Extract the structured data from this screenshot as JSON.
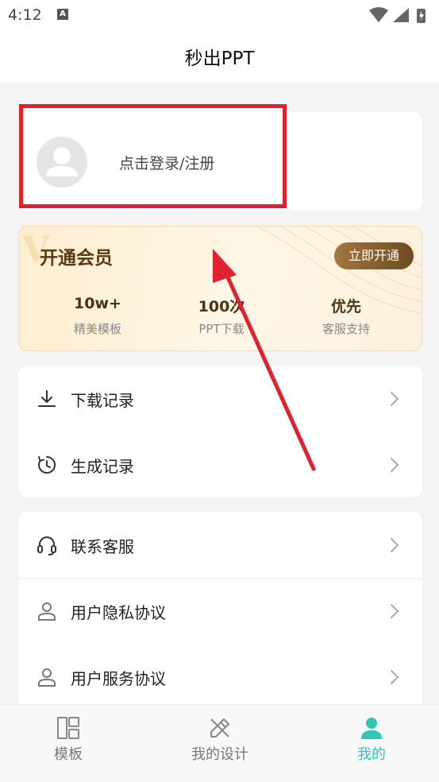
{
  "status_bar": {
    "time": "4:12",
    "notification_icon": "A"
  },
  "header": {
    "title": "秒出PPT"
  },
  "login": {
    "text": "点击登录/注册"
  },
  "vip": {
    "watermark": "V",
    "title": "开通会员",
    "button": "立即开通",
    "stats": [
      {
        "value": "10w+",
        "label": "精美模板"
      },
      {
        "value": "100次",
        "label": "PPT下载"
      },
      {
        "value": "优先",
        "label": "客服支持"
      }
    ]
  },
  "menu_group_1": [
    {
      "label": "下载记录",
      "icon": "download-icon"
    },
    {
      "label": "生成记录",
      "icon": "history-clock-icon"
    }
  ],
  "menu_group_2": [
    {
      "label": "联系客服",
      "icon": "headset-icon"
    },
    {
      "label": "用户隐私协议",
      "icon": "user-icon"
    },
    {
      "label": "用户服务协议",
      "icon": "user-icon"
    }
  ],
  "bottom_nav": [
    {
      "label": "模板",
      "icon": "template-grid-icon",
      "active": false
    },
    {
      "label": "我的设计",
      "icon": "design-pencil-icon",
      "active": false
    },
    {
      "label": "我的",
      "icon": "profile-icon",
      "active": true
    }
  ],
  "colors": {
    "accent": "#2ec7b5",
    "annotation": "#e0222e",
    "vip_text": "#5a3a14"
  }
}
